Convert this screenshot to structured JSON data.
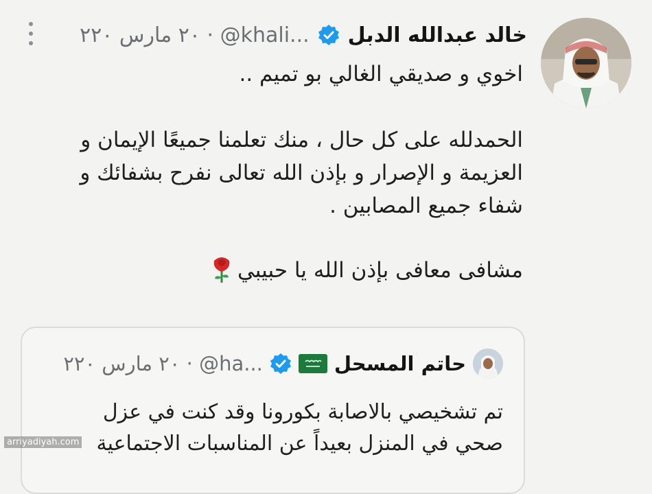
{
  "tweet": {
    "display_name": "خالد عبدالله الدبل",
    "verified_icon": "verified-badge-icon",
    "meta": "٢٠ مارس ٢٢٠ · @khali...",
    "avatar": "avatar-photo",
    "more_icon": "more-vertical-icon",
    "paragraph_1": "اخوي و صديقي الغالي بو تميم ..",
    "paragraph_2": [
      "الحمدلله على كل حال ، منك تعلمنا جميعًا الإيمان و",
      "العزيمة و الإصرار و بإذن الله تعالى نفرح بشفائك و",
      "شفاء جميع المصابين ."
    ],
    "paragraph_3": "مشافى معافى بإذن الله يا حبيبي",
    "emoji": "rose-icon"
  },
  "quote": {
    "display_name": "حاتم المسحل",
    "flag_icon": "saudi-flag-icon",
    "verified_icon": "verified-badge-icon",
    "meta": "٢٠ مارس ٢٢٠ · @ha...",
    "lines": [
      "تم تشخيصي بالاصابة بكورونا وقد كنت في عزل",
      "صحي في المنزل بعيداً عن المناسبات الاجتماعية"
    ]
  },
  "watermark": "arriyadiyah.com",
  "colors": {
    "background": "#f3f3f1",
    "verified": "#1d9bf0",
    "secondary_text": "#6b6e72",
    "flag_green": "#1b7b3a"
  }
}
